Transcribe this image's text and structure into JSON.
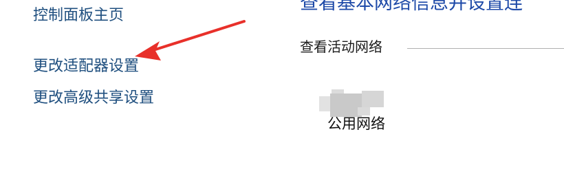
{
  "sidebar": {
    "items": [
      {
        "label": "控制面板主页"
      },
      {
        "label": "更改适配器设置"
      },
      {
        "label": "更改高级共享设置"
      }
    ]
  },
  "main": {
    "title": "查看基本网络信息并设置连",
    "active_networks_label": "查看活动网络",
    "network": {
      "type": "公用网络"
    }
  },
  "annotation": {
    "color": "#e8302a"
  }
}
